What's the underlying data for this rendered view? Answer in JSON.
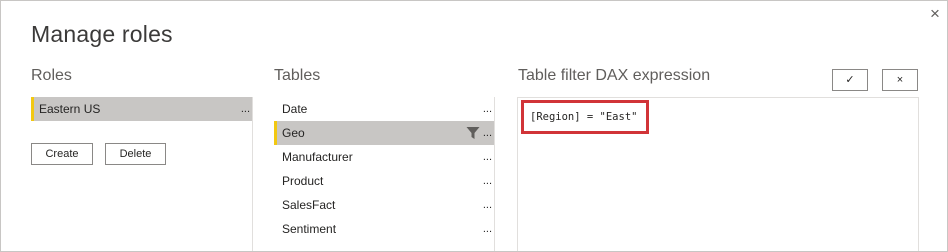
{
  "dialog": {
    "title": "Manage roles",
    "close_glyph": "×"
  },
  "roles": {
    "header": "Roles",
    "items": [
      {
        "label": "Eastern US",
        "menu": "...",
        "selected": true
      }
    ],
    "create_label": "Create",
    "delete_label": "Delete"
  },
  "tables": {
    "header": "Tables",
    "items": [
      {
        "label": "Date",
        "menu": "..."
      },
      {
        "label": "Geo",
        "menu": "...",
        "selected": true,
        "filtered": true
      },
      {
        "label": "Manufacturer",
        "menu": "..."
      },
      {
        "label": "Product",
        "menu": "..."
      },
      {
        "label": "SalesFact",
        "menu": "..."
      },
      {
        "label": "Sentiment",
        "menu": "..."
      }
    ]
  },
  "expression": {
    "header": "Table filter DAX expression",
    "confirm_glyph": "✓",
    "cancel_glyph": "×",
    "text": "[Region] = \"East\""
  },
  "colors": {
    "selected_row": "#c8c6c4",
    "selected_accent": "#f2c811",
    "highlight_border": "#d13438"
  },
  "icons": {
    "filter": "filter-icon",
    "close": "close-icon"
  }
}
